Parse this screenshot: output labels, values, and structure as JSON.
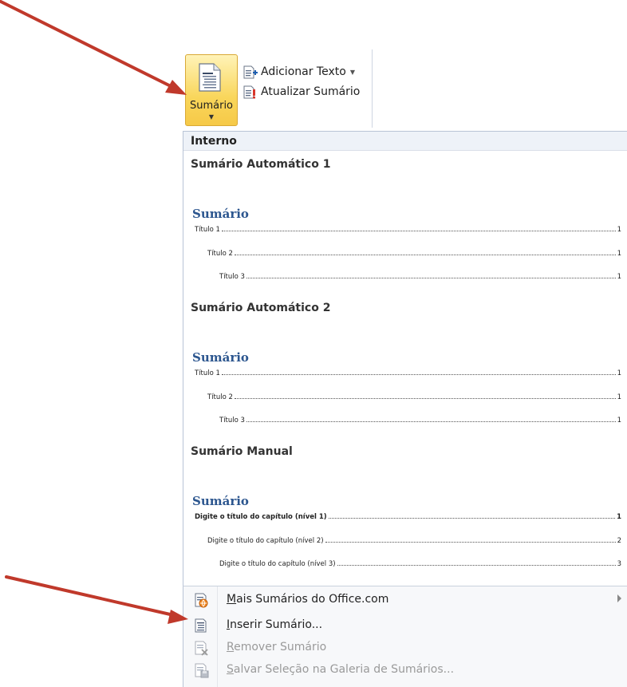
{
  "ribbon": {
    "sumario_label": "Sumário",
    "add_text_label": "Adicionar Texto",
    "update_toc_label": "Atualizar Sumário"
  },
  "gallery": {
    "section_label": "Interno",
    "presets": [
      {
        "title": "Sumário Automático 1",
        "heading": "Sumário",
        "lines": [
          {
            "text": "Título 1",
            "page": "1"
          },
          {
            "text": "Título 2",
            "page": "1"
          },
          {
            "text": "Título 3",
            "page": "1"
          }
        ]
      },
      {
        "title": "Sumário Automático 2",
        "heading": "Sumário",
        "lines": [
          {
            "text": "Título 1",
            "page": "1"
          },
          {
            "text": "Título 2",
            "page": "1"
          },
          {
            "text": "Título 3",
            "page": "1"
          }
        ]
      },
      {
        "title": "Sumário Manual",
        "heading": "Sumário",
        "lines": [
          {
            "text": "Digite o título do capítulo (nível 1)",
            "page": "1"
          },
          {
            "text": "Digite o título do capítulo (nível 2)",
            "page": "2"
          },
          {
            "text": "Digite o título do capítulo (nível 3)",
            "page": "3"
          }
        ]
      }
    ]
  },
  "menu": {
    "items": [
      {
        "accel": "M",
        "rest": "ais Sumários do Office.com",
        "enabled": true,
        "icon": "office-com-icon"
      },
      {
        "accel": "I",
        "rest": "nserir Sumário...",
        "enabled": true,
        "icon": "insert-toc-icon"
      },
      {
        "accel": "R",
        "rest": "emover Sumário",
        "enabled": false,
        "icon": "remove-toc-icon"
      },
      {
        "accel": "S",
        "rest": "alvar Seleção na Galeria de Sumários...",
        "enabled": false,
        "icon": "save-selection-icon"
      }
    ]
  },
  "colors": {
    "button_highlight": "#f9d65b",
    "heading_blue": "#2c568f",
    "arrow_red": "#c0392b"
  }
}
